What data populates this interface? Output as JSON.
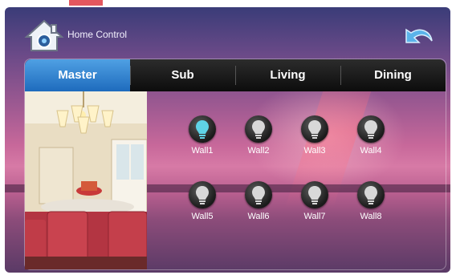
{
  "header": {
    "title": "Home Control",
    "home_icon": "home-icon",
    "back_icon": "back-arrow-icon"
  },
  "tabs": [
    {
      "label": "Master",
      "active": true
    },
    {
      "label": "Sub",
      "active": false
    },
    {
      "label": "Living",
      "active": false
    },
    {
      "label": "Dining",
      "active": false
    }
  ],
  "lights": [
    {
      "label": "Wall1",
      "on": true
    },
    {
      "label": "Wall2",
      "on": false
    },
    {
      "label": "Wall3",
      "on": false
    },
    {
      "label": "Wall4",
      "on": false
    },
    {
      "label": "Wall5",
      "on": false
    },
    {
      "label": "Wall6",
      "on": false
    },
    {
      "label": "Wall7",
      "on": false
    },
    {
      "label": "Wall8",
      "on": false
    }
  ],
  "colors": {
    "active_tab": "#2f86d6",
    "bulb_on": "#5fd3e6",
    "bulb_off": "#d8d8d8"
  }
}
